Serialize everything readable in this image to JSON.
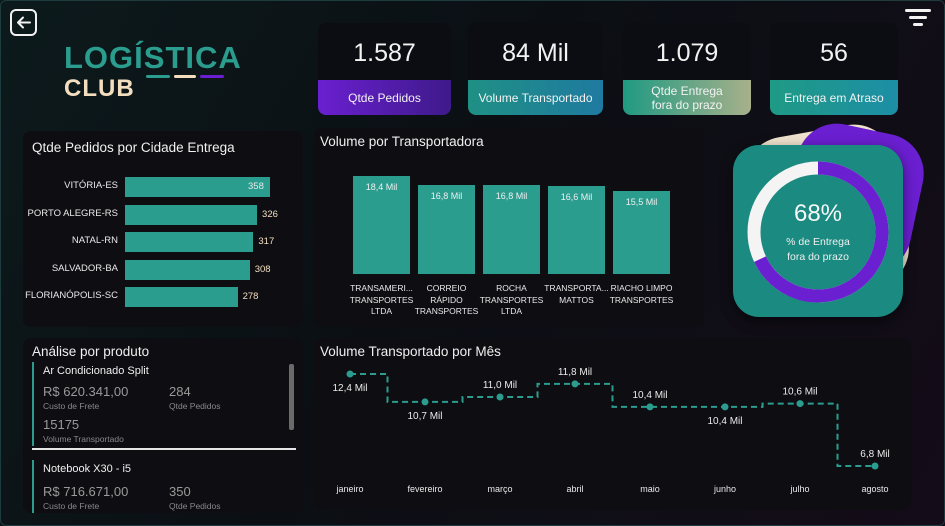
{
  "logo": {
    "line1": "LOGÍSTICA",
    "line2": "CLUB"
  },
  "kpis": [
    {
      "value": "1.587",
      "label": "Qtde Pedidos",
      "color": "#6a1fd0"
    },
    {
      "value": "84 Mil",
      "label": "Volume Transportado",
      "color": "#1e8e9a"
    },
    {
      "value": "1.079",
      "label": "Qtde Entrega fora do prazo",
      "color": "#3a9d7c"
    },
    {
      "value": "56",
      "label": "Entrega em Atraso",
      "color": "#1d8ea6"
    }
  ],
  "city_chart": {
    "title": "Qtde Pedidos por Cidade Entrega",
    "chart_data": {
      "type": "bar",
      "orientation": "horizontal",
      "categories": [
        "VITÓRIA-ES",
        "PORTO ALEGRE-RS",
        "NATAL-RN",
        "SALVADOR-BA",
        "FLORIANÓPOLIS-SC"
      ],
      "values": [
        358,
        326,
        317,
        308,
        278
      ],
      "value_labels": [
        "358",
        "326",
        "317",
        "308",
        "278"
      ],
      "color": "#2a9d8f"
    }
  },
  "carrier_chart": {
    "title": "Volume por Transportadora",
    "chart_data": {
      "type": "bar",
      "categories": [
        "TRANSAMERI... TRANSPORTES LTDA",
        "CORREIO RÁPIDO TRANSPORTES",
        "ROCHA TRANSPORTES LTDA",
        "TRANSPORTA... MATTOS",
        "RIACHO LIMPO TRANSPORTES"
      ],
      "category_lines": [
        [
          "TRANSAMERI...",
          "TRANSPORTES",
          "LTDA"
        ],
        [
          "CORREIO",
          "RÁPIDO",
          "TRANSPORTES"
        ],
        [
          "ROCHA",
          "TRANSPORTES",
          "LTDA"
        ],
        [
          "TRANSPORTA...",
          "MATTOS"
        ],
        [
          "RIACHO LIMPO",
          "TRANSPORTES"
        ]
      ],
      "values": [
        18.4,
        16.8,
        16.8,
        16.6,
        15.5
      ],
      "value_labels": [
        "18,4 Mil",
        "16,8 Mil",
        "16,8 Mil",
        "16,6 Mil",
        "15,5 Mil"
      ],
      "unit": "Mil",
      "color": "#2a9d8f"
    }
  },
  "gauge": {
    "percent": 68,
    "value_label": "68%",
    "caption_line1": "% de Entrega",
    "caption_line2": "fora do prazo",
    "colors": {
      "fill": "#6a1fd0",
      "track": "#f4f4f4",
      "card": "#1b8a80"
    }
  },
  "products": {
    "title": "Análise por produto",
    "items": [
      {
        "name": "Ar Condicionado Split",
        "freight": "R$ 620.341,00",
        "freight_label": "Custo de Frete",
        "orders": "284",
        "orders_label": "Qtde Pedidos",
        "volume": "15175",
        "volume_label": "Volume Transportado"
      },
      {
        "name": "Notebook X30 - i5",
        "freight": "R$ 716.671,00",
        "freight_label": "Custo de Frete",
        "orders": "350",
        "orders_label": "Qtde Pedidos"
      }
    ]
  },
  "monthly_chart": {
    "title": "Volume Transportado por Mês",
    "chart_data": {
      "type": "line",
      "step": true,
      "categories": [
        "janeiro",
        "fevereiro",
        "março",
        "abril",
        "maio",
        "junho",
        "julho",
        "agosto"
      ],
      "values": [
        12.4,
        10.7,
        11.0,
        11.8,
        10.4,
        10.4,
        10.6,
        6.8
      ],
      "value_labels": [
        "12,4 Mil",
        "10,7 Mil",
        "11,0 Mil",
        "11,8 Mil",
        "10,4 Mil",
        "10,4 Mil",
        "10,6 Mil",
        "6,8 Mil"
      ],
      "unit": "Mil",
      "color": "#2a9d8f"
    }
  }
}
